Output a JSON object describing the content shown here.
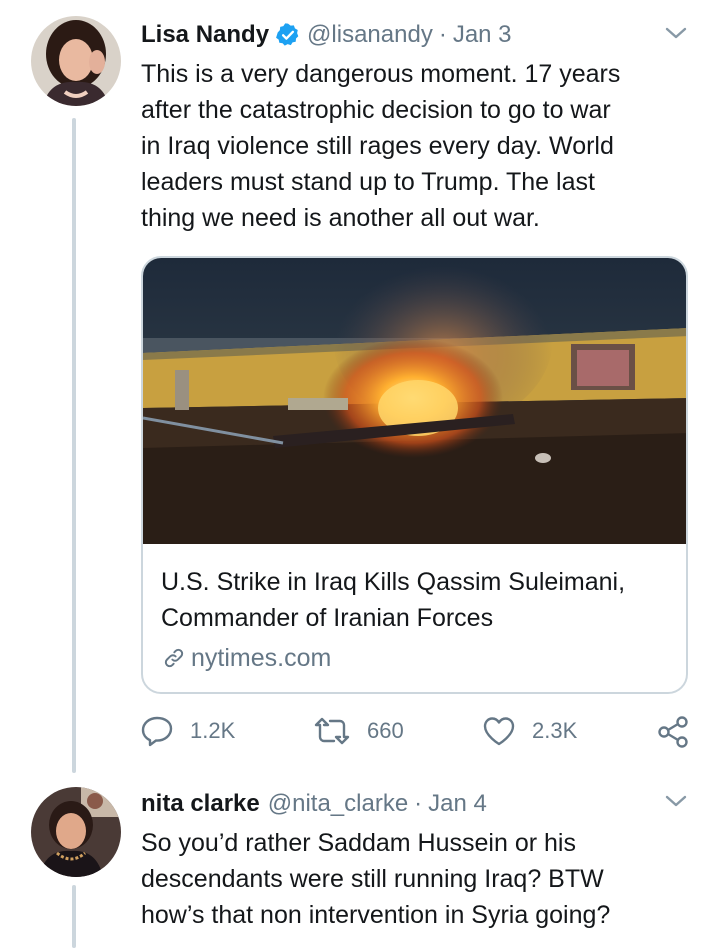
{
  "tweet1": {
    "display_name": "Lisa Nandy",
    "handle": "@lisanandy",
    "separator": "·",
    "date": "Jan 3",
    "text_lines": [
      "This is a very dangerous moment. 17 years",
      "after the catastrophic decision to go to war",
      "in Iraq violence still rages every day. World",
      "leaders must stand up to Trump. The last",
      "thing we need is another all out war."
    ],
    "card": {
      "title_lines": [
        "U.S. Strike in Iraq Kills Qassim Suleimani,",
        "Commander of Iranian Forces"
      ],
      "domain": "nytimes.com"
    },
    "actions": {
      "replies": "1.2K",
      "retweets": "660",
      "likes": "2.3K"
    }
  },
  "tweet2": {
    "display_name": "nita clarke",
    "handle": "@nita_clarke",
    "separator": "·",
    "date": "Jan 4",
    "text_lines": [
      "So you’d rather Saddam Hussein or his",
      "descendants were still running Iraq? BTW",
      "how’s that non intervention in Syria going?"
    ]
  },
  "colors": {
    "text": "#14171a",
    "secondary": "#657786",
    "verified": "#1da1f2",
    "thread_line": "#ccd6dd",
    "card_border": "#ccd6dd"
  },
  "icons": [
    "verified-badge-icon",
    "chevron-down-icon",
    "link-icon",
    "reply-icon",
    "retweet-icon",
    "like-icon",
    "share-icon"
  ]
}
